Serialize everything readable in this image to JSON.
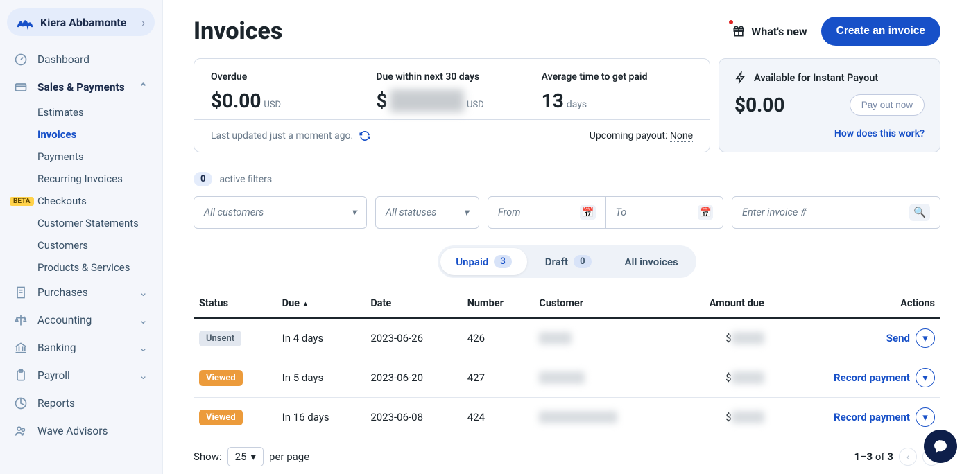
{
  "user": {
    "name": "Kiera Abbamonte"
  },
  "sidebar": {
    "dashboard": "Dashboard",
    "sales": "Sales & Payments",
    "sales_items": [
      {
        "label": "Estimates"
      },
      {
        "label": "Invoices",
        "active": true
      },
      {
        "label": "Payments"
      },
      {
        "label": "Recurring Invoices"
      },
      {
        "label": "Checkouts",
        "badge": "BETA"
      },
      {
        "label": "Customer Statements"
      },
      {
        "label": "Customers"
      },
      {
        "label": "Products & Services"
      }
    ],
    "purchases": "Purchases",
    "accounting": "Accounting",
    "banking": "Banking",
    "payroll": "Payroll",
    "reports": "Reports",
    "advisors": "Wave Advisors"
  },
  "page": {
    "title": "Invoices",
    "whats_new": "What's new",
    "create_btn": "Create an invoice"
  },
  "summary": {
    "overdue": {
      "label": "Overdue",
      "value": "$0.00",
      "currency": "USD"
    },
    "due30": {
      "label": "Due within next 30 days",
      "prefix": "$",
      "value_blurred": "XXXXXX",
      "currency": "USD"
    },
    "avgtime": {
      "label": "Average time to get paid",
      "value": "13",
      "unit": "days"
    },
    "updated": "Last updated just a moment ago.",
    "upcoming_label": "Upcoming payout:",
    "upcoming_value": "None"
  },
  "payout": {
    "title": "Available for Instant Payout",
    "amount": "$0.00",
    "btn": "Pay out now",
    "how": "How does this work?"
  },
  "filters": {
    "count": "0",
    "label": "active filters",
    "customers_ph": "All customers",
    "statuses_ph": "All statuses",
    "from_ph": "From",
    "to_ph": "To",
    "search_ph": "Enter invoice #"
  },
  "tabs": {
    "unpaid": {
      "label": "Unpaid",
      "count": "3"
    },
    "draft": {
      "label": "Draft",
      "count": "0"
    },
    "all": {
      "label": "All invoices"
    }
  },
  "table": {
    "headers": {
      "status": "Status",
      "due": "Due",
      "date": "Date",
      "number": "Number",
      "customer": "Customer",
      "amount": "Amount due",
      "actions": "Actions"
    },
    "rows": [
      {
        "status": "Unsent",
        "status_class": "unsent",
        "due": "In 4 days",
        "date": "2023-06-26",
        "number": "426",
        "customer_blurred": "XXXXX",
        "amount_prefix": "$",
        "amount_blurred": "XXXXX",
        "action": "Send"
      },
      {
        "status": "Viewed",
        "status_class": "viewed",
        "due": "In 5 days",
        "date": "2023-06-20",
        "number": "427",
        "customer_blurred": "XXXXXXX",
        "amount_prefix": "$",
        "amount_blurred": "XXXXX",
        "action": "Record payment"
      },
      {
        "status": "Viewed",
        "status_class": "viewed",
        "due": "In 16 days",
        "date": "2023-06-08",
        "number": "424",
        "customer_blurred": "XXXXXXXXXXXX",
        "amount_prefix": "$",
        "amount_blurred": "XXXXX",
        "action": "Record payment"
      }
    ]
  },
  "pager": {
    "show": "Show:",
    "per_page_val": "25",
    "per_page_suffix": "per page",
    "range": "1–3",
    "of": "of",
    "total": "3"
  }
}
